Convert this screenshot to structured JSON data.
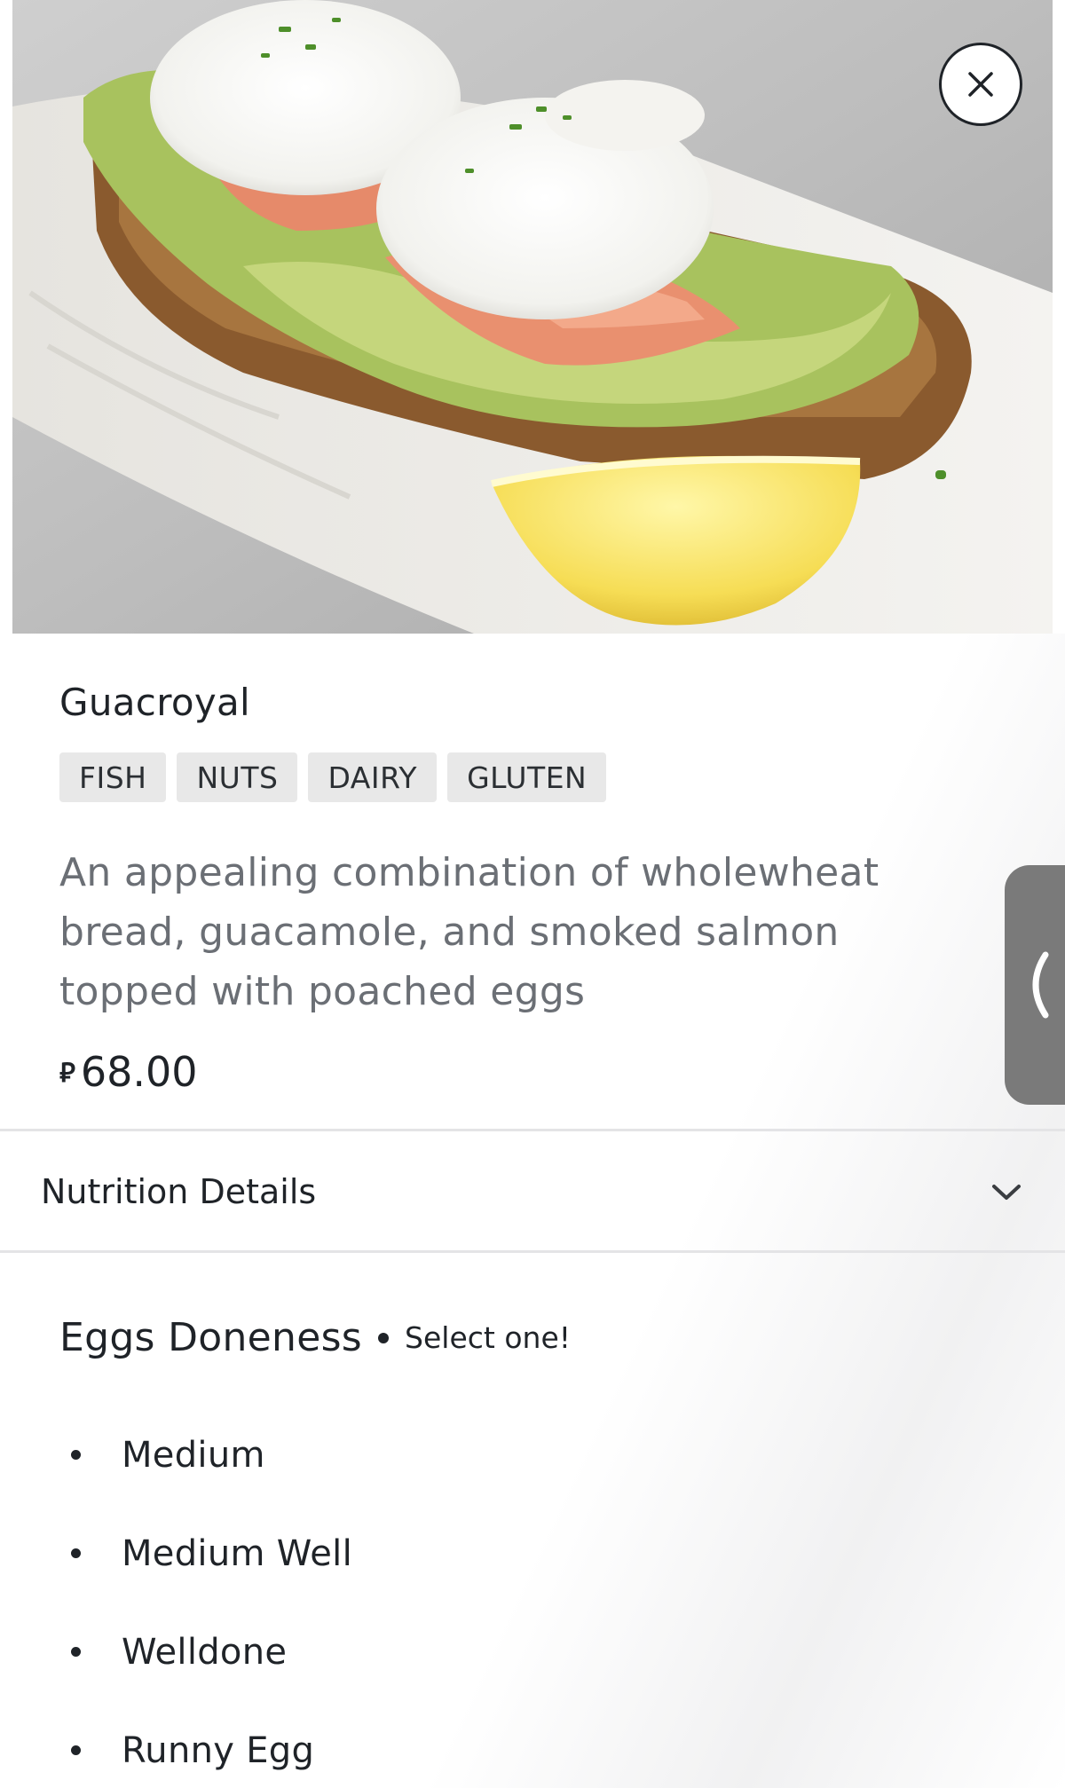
{
  "item": {
    "title": "Guacroyal",
    "tags": [
      "FISH",
      "NUTS",
      "DAIRY",
      "GLUTEN"
    ],
    "description": "An appealing combination of wholewheat bread, guacamole, and smoked salmon topped with poached eggs",
    "price_currency": "⃁",
    "price_value": "68.00"
  },
  "nutrition": {
    "label": "Nutrition Details"
  },
  "options_group": {
    "title": "Eggs Doneness",
    "hint": "Select one!",
    "options": [
      "Medium",
      "Medium Well",
      "Welldone",
      "Runny Egg"
    ]
  },
  "icons": {
    "close": "close-icon",
    "chevron_down": "chevron-down-icon",
    "side_tab": "chevron-left-icon"
  },
  "colors": {
    "tag_bg": "#e8e8e8",
    "description_text": "#6b6f75",
    "side_tab_bg": "#7a7a7a"
  }
}
